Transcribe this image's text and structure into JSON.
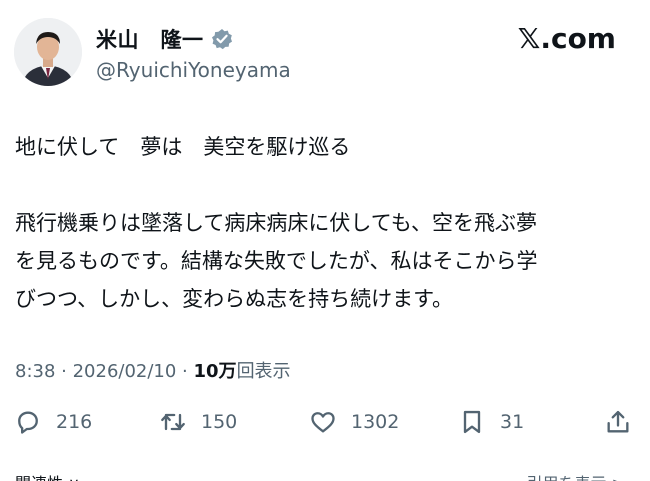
{
  "author": {
    "name": "米山　隆一",
    "handle": "@RyuichiYoneyama",
    "verified": true,
    "avatar_icon": "profile-photo-man-in-suit"
  },
  "site_logo": "𝕏.com",
  "post": {
    "line1": "地に伏して　夢は　美空を駆け巡る",
    "line2": "飛行機乗りは墜落して病床病床に伏しても、空を飛ぶ夢",
    "line3": "を見るものです。結構な失敗でしたが、私はそこから学",
    "line4": "びつつ、しかし、変わらぬ志を持ち続けます。"
  },
  "meta": {
    "time_date": "8:38 · 2026/02/10 · ",
    "views_number": "10万",
    "views_label": "回表示"
  },
  "actions": {
    "reply_count": "216",
    "repost_count": "150",
    "like_count": "1302",
    "bookmark_count": "31"
  },
  "footer": {
    "left": "関連性 ∨",
    "right": "引用を表示 >"
  },
  "colors": {
    "text": "#0f1419",
    "secondary": "#536471",
    "verified": "#829aab"
  }
}
